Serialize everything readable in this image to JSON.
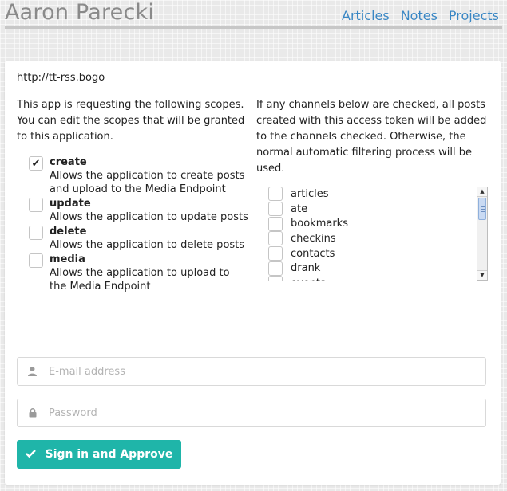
{
  "header": {
    "site_title": "Aaron Parecki",
    "nav": [
      {
        "label": "Articles"
      },
      {
        "label": "Notes"
      },
      {
        "label": "Projects"
      }
    ]
  },
  "auth": {
    "client_url": "http://tt-rss.bogo",
    "scopes_intro": "This app is requesting the following scopes. You can edit the scopes that will be granted to this application.",
    "scopes": [
      {
        "name": "create",
        "description": "Allows the application to create posts and upload to the Media Endpoint",
        "checked": true
      },
      {
        "name": "update",
        "description": "Allows the application to update posts",
        "checked": false
      },
      {
        "name": "delete",
        "description": "Allows the application to delete posts",
        "checked": false
      },
      {
        "name": "media",
        "description": "Allows the application to upload to the Media Endpoint",
        "checked": false
      }
    ],
    "channels_intro": "If any channels below are checked, all posts created with this access token will be added to the channels checked. Otherwise, the normal automatic filtering process will be used.",
    "channels": [
      "articles",
      "ate",
      "bookmarks",
      "checkins",
      "contacts",
      "drank",
      "events"
    ],
    "email_placeholder": "E-mail address",
    "password_placeholder": "Password",
    "approve_label": "Sign in and Approve",
    "accent_color": "#1fb5a9"
  }
}
